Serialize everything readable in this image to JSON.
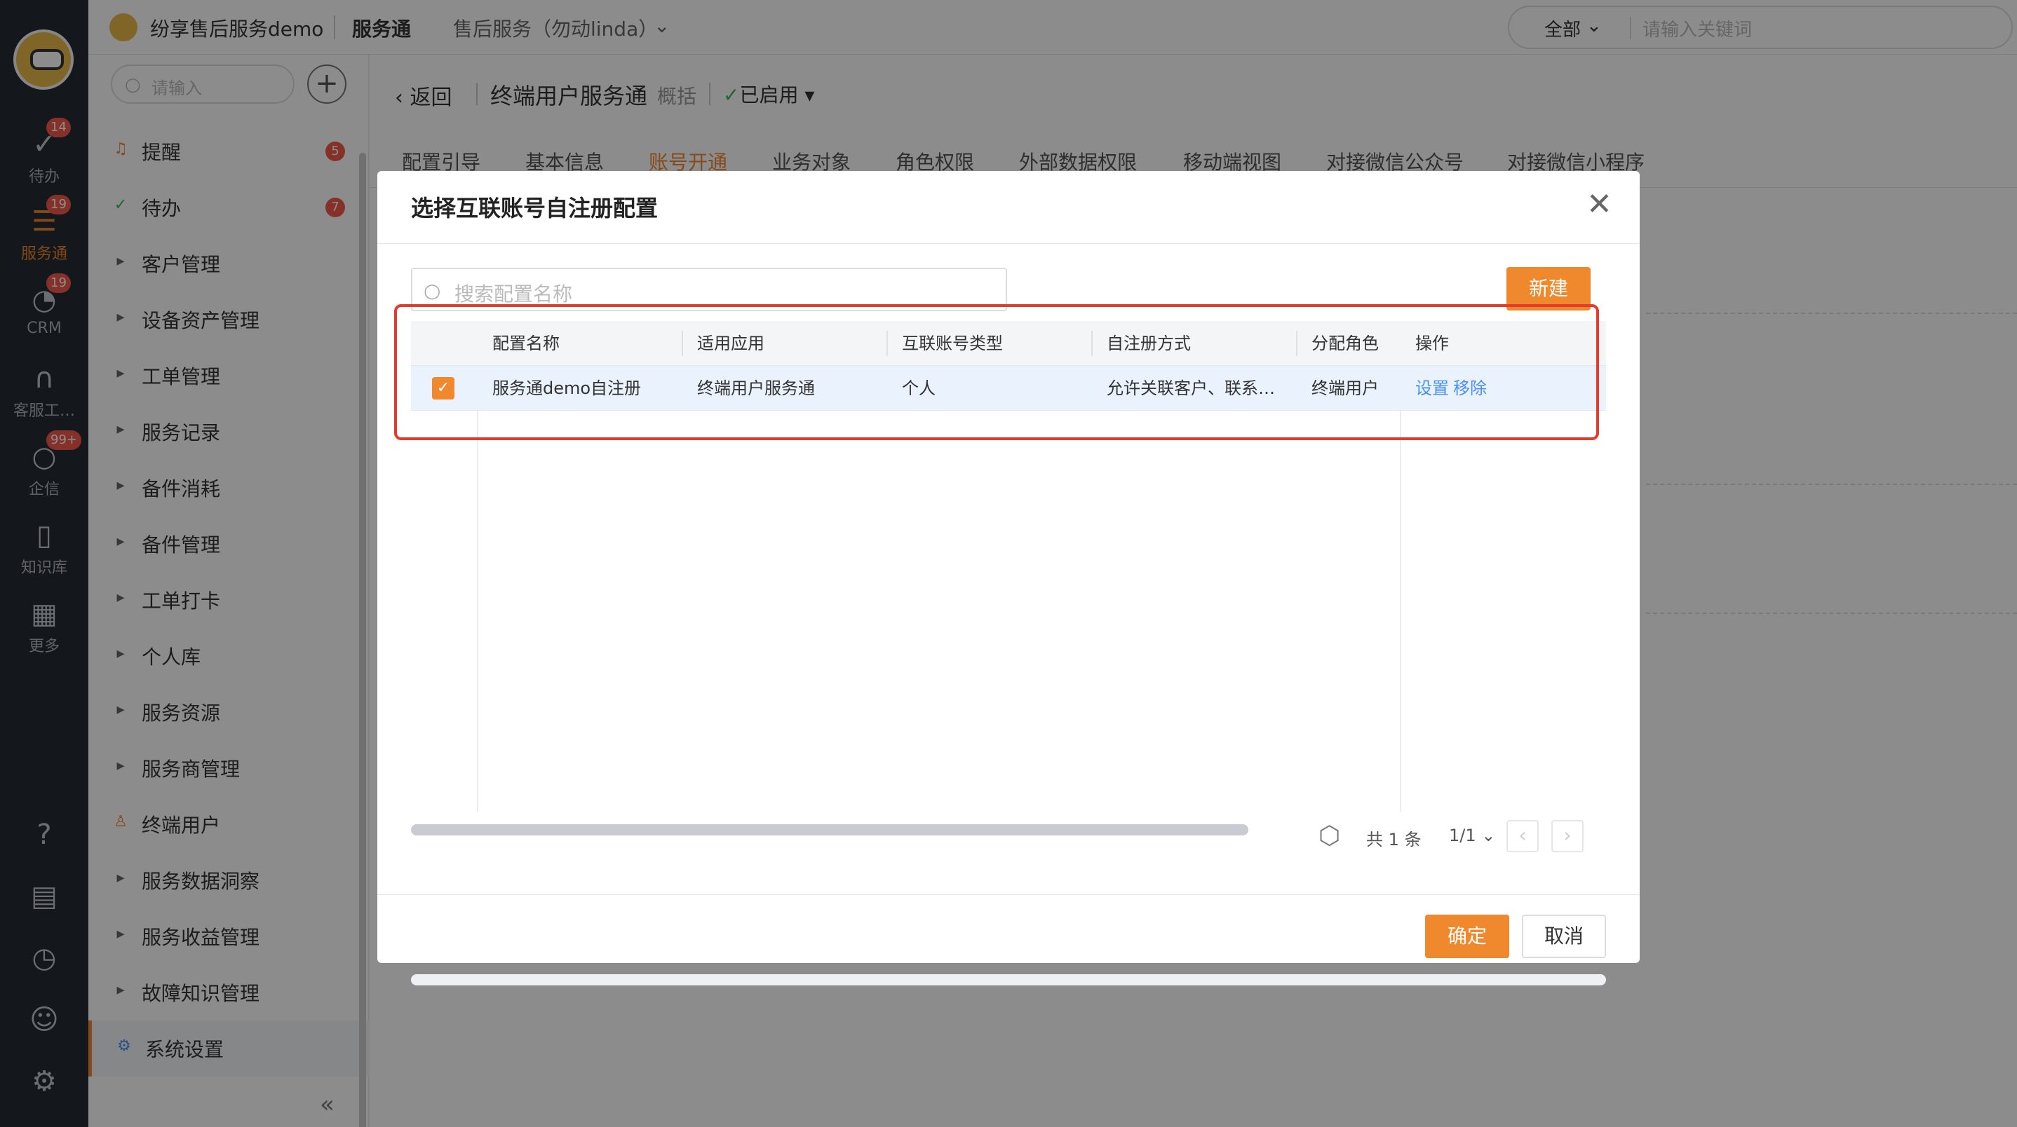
{
  "rail": {
    "items": [
      {
        "label": "待办",
        "badge": "14",
        "icon": "check-circle-icon"
      },
      {
        "label": "服务通",
        "badge": "19",
        "icon": "service-icon"
      },
      {
        "label": "CRM",
        "badge": "19",
        "icon": "pie-chart-icon"
      },
      {
        "label": "客服工…",
        "badge": "",
        "icon": "headset-icon"
      },
      {
        "label": "企信",
        "badge": "99+",
        "icon": "chat-icon"
      },
      {
        "label": "知识库",
        "badge": "",
        "icon": "book-icon"
      },
      {
        "label": "更多",
        "badge": "",
        "icon": "grid-icon"
      }
    ]
  },
  "topbar": {
    "app_name": "纷享售后服务demo",
    "module": "服务通",
    "dept": "售后服务（勿动linda）",
    "scope": "全部",
    "keyword_placeholder": "请输入关键词"
  },
  "side": {
    "search_placeholder": "请输入",
    "items": [
      {
        "label": "提醒",
        "badge": "5"
      },
      {
        "label": "待办",
        "badge": "7"
      },
      {
        "label": "客户管理",
        "badge": ""
      },
      {
        "label": "设备资产管理",
        "badge": ""
      },
      {
        "label": "工单管理",
        "badge": ""
      },
      {
        "label": "服务记录",
        "badge": ""
      },
      {
        "label": "备件消耗",
        "badge": ""
      },
      {
        "label": "备件管理",
        "badge": ""
      },
      {
        "label": "工单打卡",
        "badge": ""
      },
      {
        "label": "个人库",
        "badge": ""
      },
      {
        "label": "服务资源",
        "badge": ""
      },
      {
        "label": "服务商管理",
        "badge": ""
      },
      {
        "label": "终端用户",
        "badge": ""
      },
      {
        "label": "服务数据洞察",
        "badge": ""
      },
      {
        "label": "服务收益管理",
        "badge": ""
      },
      {
        "label": "故障知识管理",
        "badge": ""
      },
      {
        "label": "系统设置",
        "badge": ""
      }
    ]
  },
  "main": {
    "back": "返回",
    "title": "终端用户服务通",
    "overview": "概括",
    "status": "已启用",
    "tabs": [
      "配置引导",
      "基本信息",
      "账号开通",
      "业务对象",
      "角色权限",
      "外部数据权限",
      "移动端视图",
      "对接微信公众号",
      "对接微信小程序"
    ],
    "active_tab": "账号开通"
  },
  "modal": {
    "title": "选择互联账号自注册配置",
    "search_placeholder": "搜索配置名称",
    "new_label": "新建",
    "columns": [
      "配置名称",
      "适用应用",
      "互联账号类型",
      "自注册方式",
      "分配角色",
      "操作"
    ],
    "rows": [
      {
        "name": "服务通demo自注册",
        "app": "终端用户服务通",
        "account_type": "个人",
        "method": "允许关联客户、联系…",
        "role": "终端用户",
        "action_set": "设置",
        "action_remove": "移除",
        "checked": true
      }
    ],
    "pager": {
      "total": "共 1 条",
      "page": "1/1"
    },
    "ok_label": "确定",
    "cancel_label": "取消"
  },
  "colors": {
    "accent": "#f0882e",
    "link": "#4a8ff5",
    "highlight": "#e33b2e",
    "rail": "#262a34"
  }
}
